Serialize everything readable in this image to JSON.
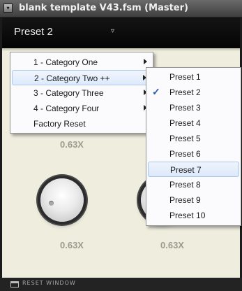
{
  "window": {
    "title": "blank template V43.fsm (Master)",
    "menu_glyph": "▾"
  },
  "preset_bar": {
    "current_preset": "Preset 2",
    "dropdown_glyph": "▿"
  },
  "knobs": [
    {
      "value": "0.63X"
    },
    {
      "value": "0.63X"
    },
    {
      "value": "0.63X"
    }
  ],
  "menu": {
    "items": [
      {
        "label": "1 - Category One",
        "has_submenu": true
      },
      {
        "label": "2 - Category Two ++",
        "has_submenu": true,
        "highlighted": true
      },
      {
        "label": "3 - Category Three",
        "has_submenu": true
      },
      {
        "label": "4 - Category Four",
        "has_submenu": true
      },
      {
        "label": "Factory Reset",
        "has_submenu": false
      }
    ]
  },
  "submenu": {
    "checkmark": "✓",
    "items": [
      {
        "label": "Preset 1"
      },
      {
        "label": "Preset 2",
        "checked": true
      },
      {
        "label": "Preset 3"
      },
      {
        "label": "Preset 4"
      },
      {
        "label": "Preset 5"
      },
      {
        "label": "Preset 6"
      },
      {
        "label": "Preset 7",
        "highlighted": true
      },
      {
        "label": "Preset 8"
      },
      {
        "label": "Preset 9"
      },
      {
        "label": "Preset 10"
      }
    ]
  },
  "footer": {
    "label": "RESET WINDOW"
  }
}
